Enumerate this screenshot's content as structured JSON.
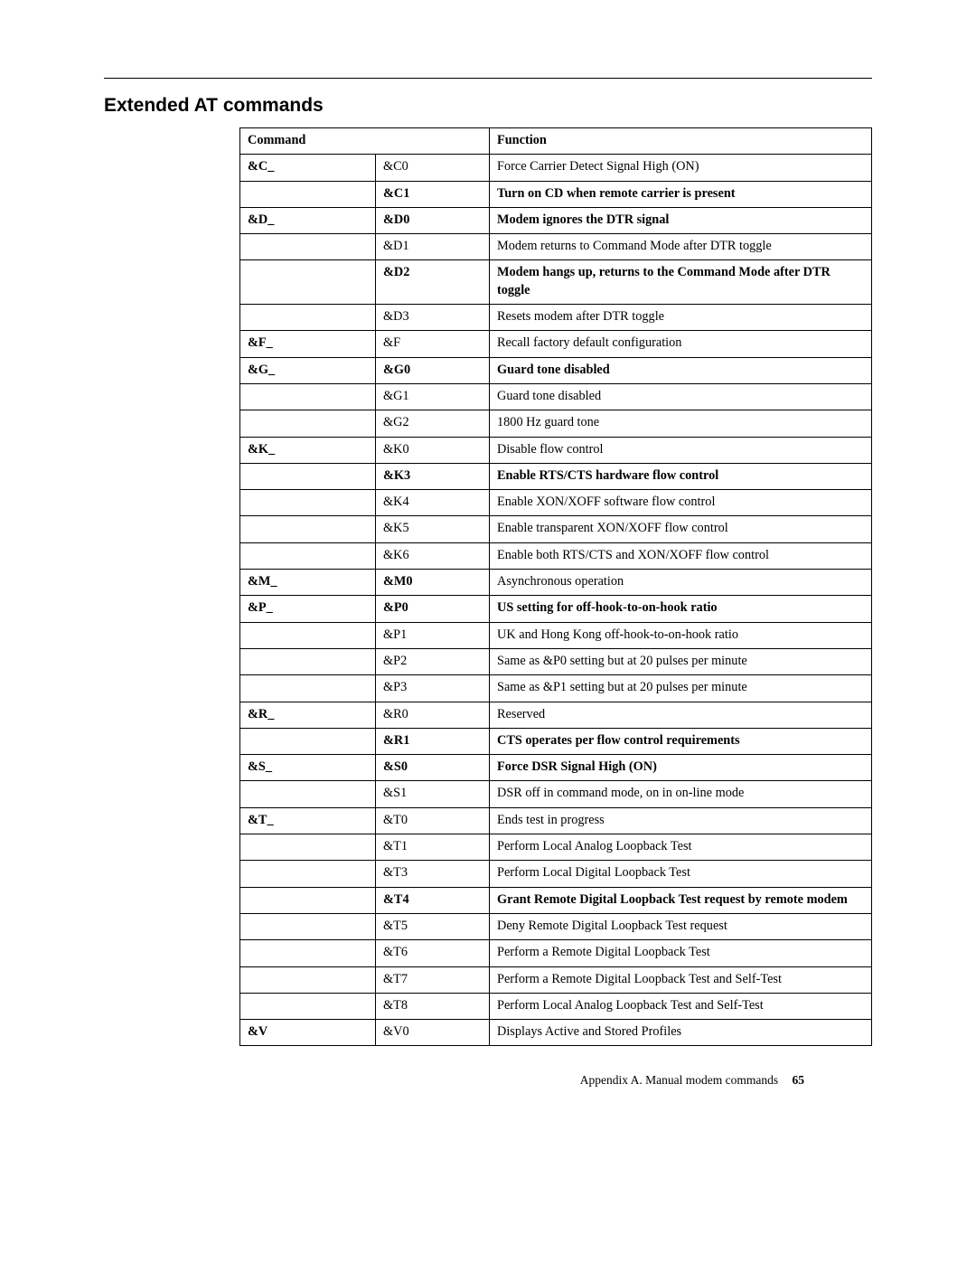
{
  "heading": "Extended AT commands",
  "table": {
    "header": {
      "command": "Command",
      "func": "Function"
    },
    "rows": [
      {
        "cmd": "&C_",
        "code": "&C0",
        "func": "Force Carrier Detect Signal High (ON)",
        "bold_cmd": true,
        "bold_code": false,
        "bold_func": false
      },
      {
        "cmd": "",
        "code": "&C1",
        "func": "Turn on CD when remote carrier is present",
        "bold_code": true,
        "bold_func": true
      },
      {
        "cmd": "&D_",
        "code": "&D0",
        "func": "Modem ignores the DTR signal",
        "bold_cmd": true,
        "bold_code": true,
        "bold_func": true
      },
      {
        "cmd": "",
        "code": "&D1",
        "func": "Modem returns to Command Mode after DTR toggle"
      },
      {
        "cmd": "",
        "code": "&D2",
        "func": "Modem hangs up, returns to the Command Mode after DTR toggle",
        "bold_code": true,
        "bold_func": true
      },
      {
        "cmd": "",
        "code": "&D3",
        "func": "Resets modem after DTR toggle"
      },
      {
        "cmd": "&F_",
        "code": "&F",
        "func": "Recall factory default configuration",
        "bold_cmd": true
      },
      {
        "cmd": "&G_",
        "code": "&G0",
        "func": "Guard tone disabled",
        "bold_cmd": true,
        "bold_code": true,
        "bold_func": true
      },
      {
        "cmd": "",
        "code": "&G1",
        "func": "Guard tone disabled"
      },
      {
        "cmd": "",
        "code": "&G2",
        "func": "1800 Hz guard tone"
      },
      {
        "cmd": "&K_",
        "code": "&K0",
        "func": "Disable flow control",
        "bold_cmd": true
      },
      {
        "cmd": "",
        "code": "&K3",
        "func": "Enable RTS/CTS hardware flow control",
        "bold_code": true,
        "bold_func": true
      },
      {
        "cmd": "",
        "code": "&K4",
        "func": "Enable XON/XOFF software flow control"
      },
      {
        "cmd": "",
        "code": "&K5",
        "func": "Enable transparent XON/XOFF flow control"
      },
      {
        "cmd": "",
        "code": "&K6",
        "func": "Enable both RTS/CTS and XON/XOFF flow control"
      },
      {
        "cmd": "&M_",
        "code": "&M0",
        "func": "Asynchronous operation",
        "bold_cmd": true,
        "bold_code": true
      },
      {
        "cmd": "&P_",
        "code": "&P0",
        "func": "US setting for off-hook-to-on-hook ratio",
        "bold_cmd": true,
        "bold_code": true,
        "bold_func": true
      },
      {
        "cmd": "",
        "code": "&P1",
        "func": "UK and Hong Kong off-hook-to-on-hook ratio"
      },
      {
        "cmd": "",
        "code": "&P2",
        "func": "Same as &P0 setting but at 20 pulses per minute"
      },
      {
        "cmd": "",
        "code": "&P3",
        "func": "Same as &P1 setting but at 20 pulses per minute"
      },
      {
        "cmd": "&R_",
        "code": "&R0",
        "func": "Reserved",
        "bold_cmd": true
      },
      {
        "cmd": "",
        "code": "&R1",
        "func": "CTS operates per flow control requirements",
        "bold_code": true,
        "bold_func": true
      },
      {
        "cmd": "&S_",
        "code": "&S0",
        "func": "Force DSR Signal High (ON)",
        "bold_cmd": true,
        "bold_code": true,
        "bold_func": true
      },
      {
        "cmd": "",
        "code": "&S1",
        "func": "DSR off in command mode, on in on-line mode"
      },
      {
        "cmd": "&T_",
        "code": "&T0",
        "func": "Ends test in progress",
        "bold_cmd": true
      },
      {
        "cmd": "",
        "code": "&T1",
        "func": "Perform Local Analog Loopback Test"
      },
      {
        "cmd": "",
        "code": "&T3",
        "func": "Perform Local Digital Loopback Test"
      },
      {
        "cmd": "",
        "code": "&T4",
        "func": "Grant Remote Digital Loopback Test request by remote modem",
        "bold_code": true,
        "bold_func": true
      },
      {
        "cmd": "",
        "code": "&T5",
        "func": "Deny Remote Digital Loopback Test request"
      },
      {
        "cmd": "",
        "code": "&T6",
        "func": "Perform a Remote Digital Loopback Test"
      },
      {
        "cmd": "",
        "code": "&T7",
        "func": "Perform a Remote Digital Loopback Test and Self-Test"
      },
      {
        "cmd": "",
        "code": "&T8",
        "func": "Perform Local Analog Loopback Test and Self-Test"
      },
      {
        "cmd": "&V",
        "code": "&V0",
        "func": "Displays Active and Stored Profiles",
        "bold_cmd": true
      }
    ]
  },
  "footer": {
    "text": "Appendix A. Manual modem commands",
    "page": "65"
  }
}
